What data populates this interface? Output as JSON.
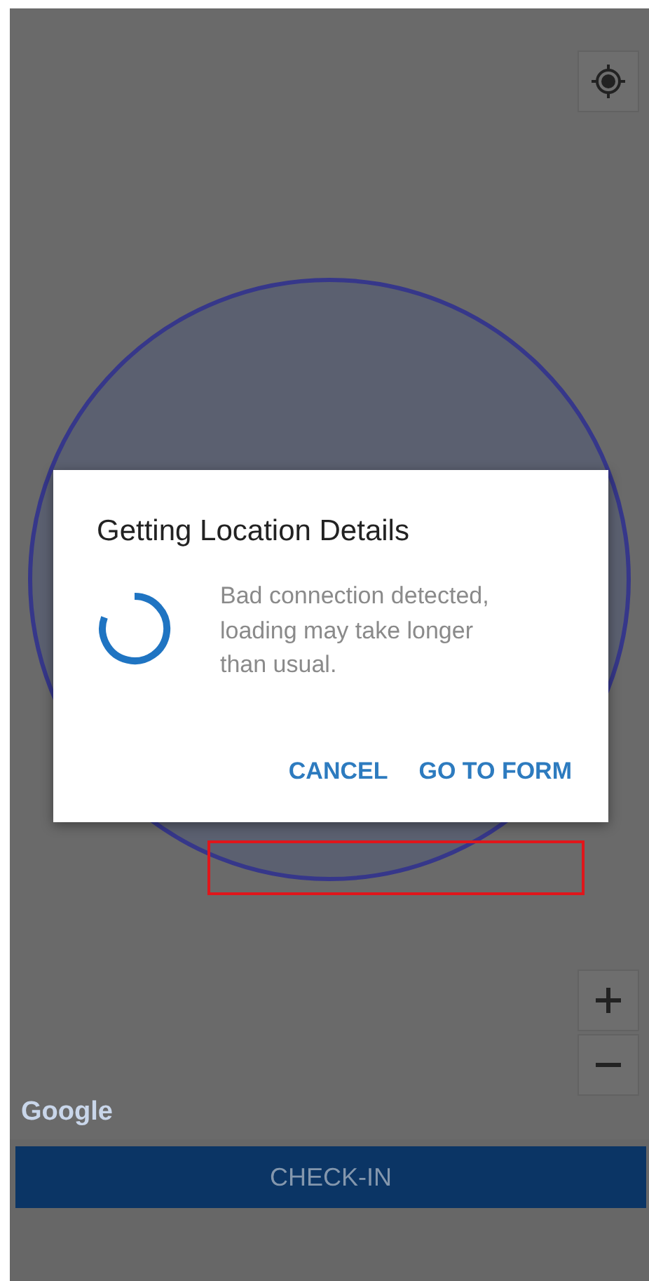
{
  "map": {
    "attribution": "Google"
  },
  "dialog": {
    "title": "Getting Location Details",
    "message": "Bad connection detected, loading may take longer than usual.",
    "buttons": [
      "CANCEL",
      "GO TO FORM"
    ]
  },
  "check_in_button": "CHECK-IN"
}
